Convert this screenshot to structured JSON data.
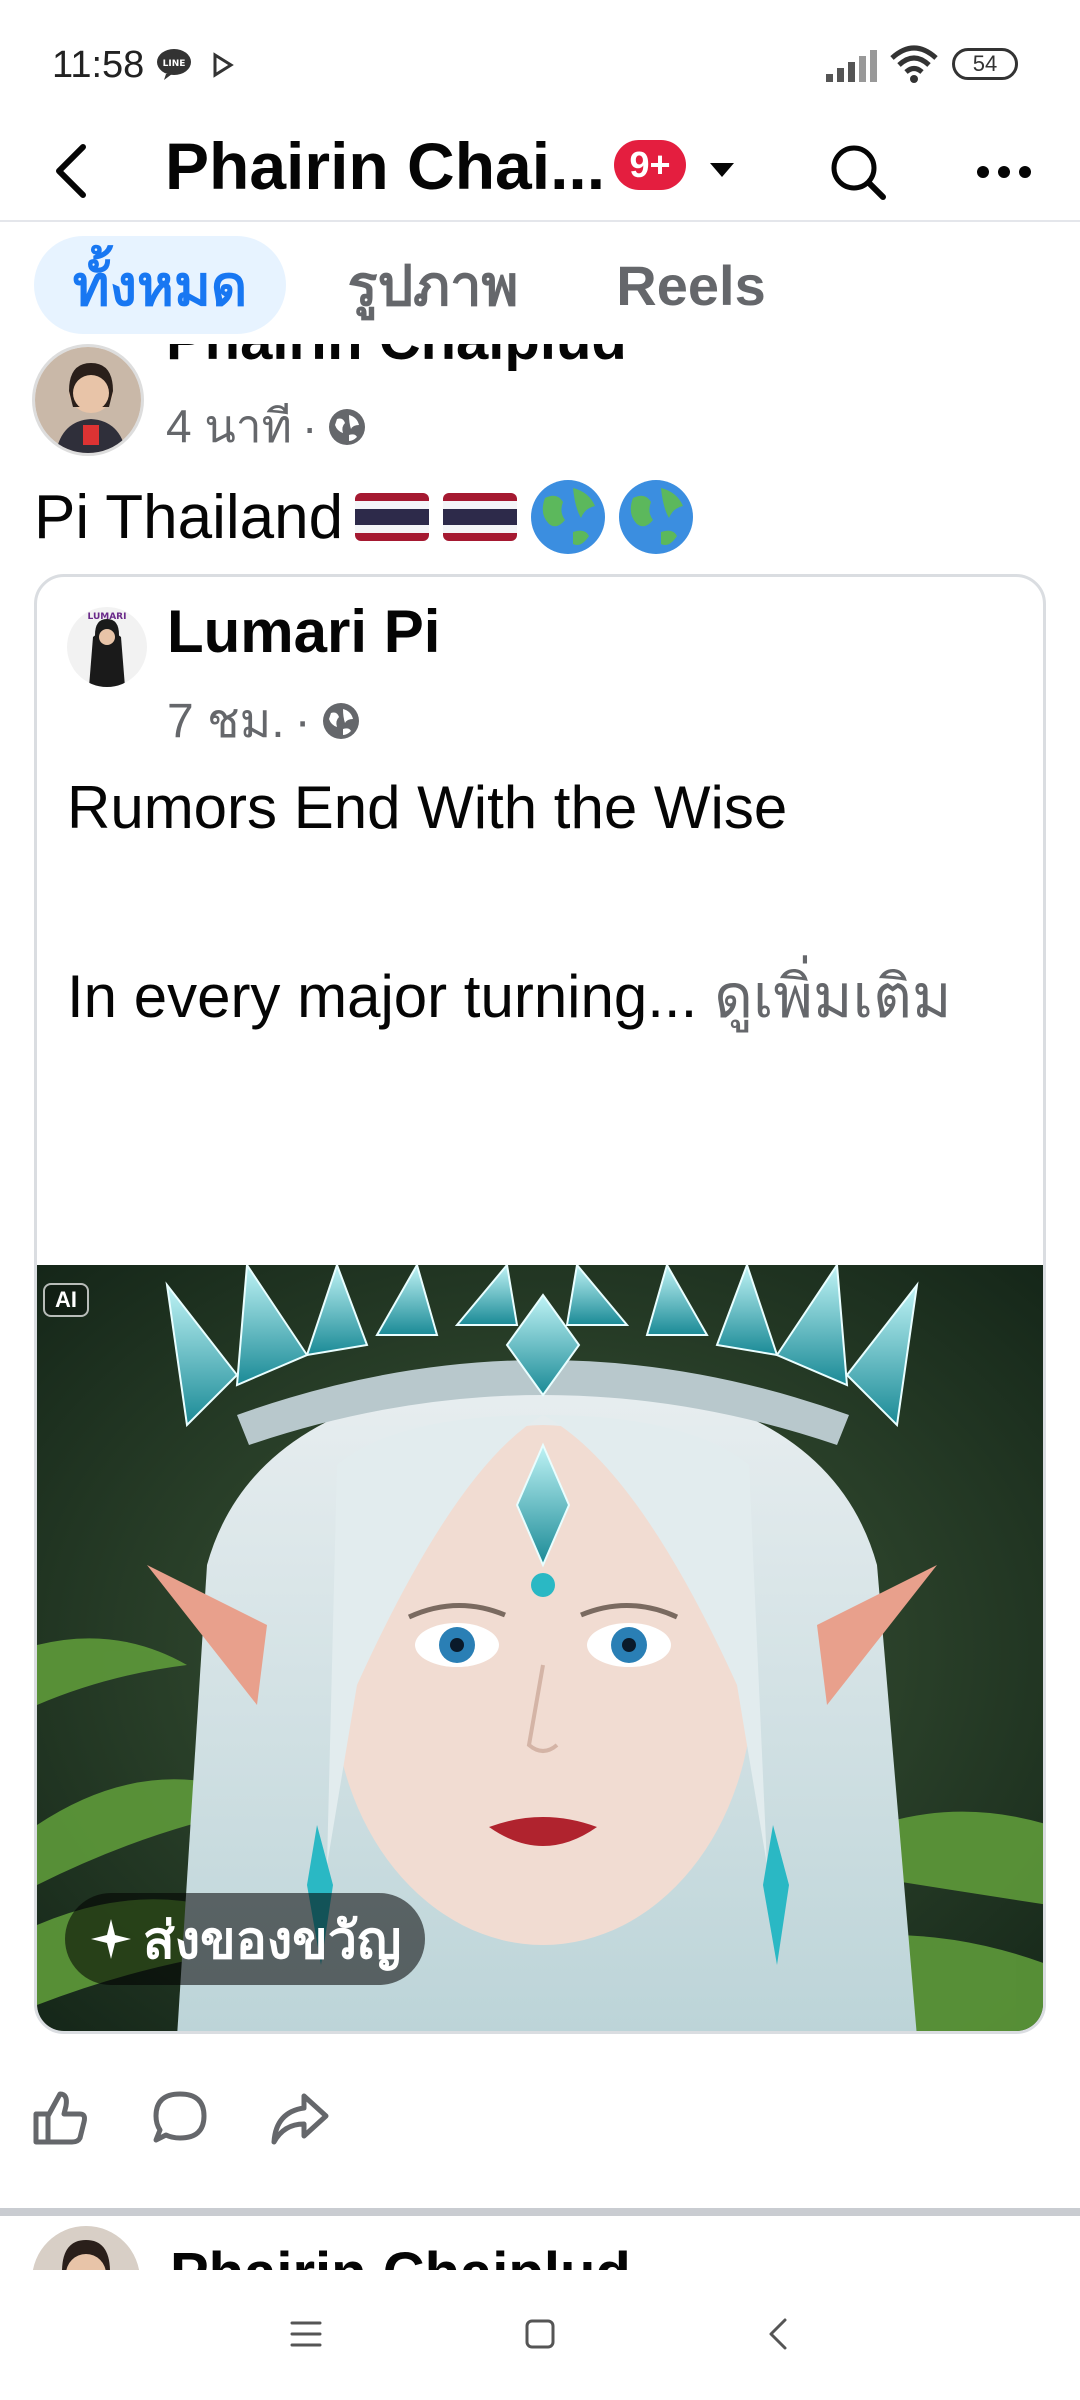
{
  "status_bar": {
    "time": "11:58",
    "battery": "54",
    "icons": [
      "line-app-icon",
      "play-icon",
      "signal-icon",
      "wifi-icon",
      "battery-icon"
    ]
  },
  "header": {
    "title": "Phairin Chai...",
    "notification_count": "9+",
    "icons": [
      "back-arrow-icon",
      "dropdown-caret-icon",
      "search-icon",
      "more-icon"
    ]
  },
  "tabs": [
    {
      "label": "ทั้งหมด",
      "active": true
    },
    {
      "label": "รูปภาพ",
      "active": false
    },
    {
      "label": "Reels",
      "active": false
    }
  ],
  "post": {
    "author": "Phairin Chaiplud",
    "time": "4 นาที",
    "separator": "·",
    "text": "Pi Thailand",
    "emojis": [
      "thai-flag-icon",
      "thai-flag-icon",
      "globe-icon",
      "globe-icon"
    ],
    "shared": {
      "author": "Lumari Pi",
      "time": "7 ชม.",
      "separator": "·",
      "line1": "Rumors End With the Wise",
      "line2": "In every major turning...",
      "see_more": "ดูเพิ่มเติม",
      "ai_label": "AI",
      "gift_label": "ส่งของขวัญ"
    },
    "actions": [
      "like-icon",
      "comment-icon",
      "share-icon"
    ]
  },
  "next_post": {
    "author": "Phairin Chaiplud"
  },
  "nav_bar": [
    "menu-icon",
    "home-icon",
    "back-icon"
  ],
  "colors": {
    "accent": "#1877f2",
    "tab_active_bg": "#e7f3ff",
    "badge": "#e41e3f",
    "secondary_text": "#65676b"
  }
}
